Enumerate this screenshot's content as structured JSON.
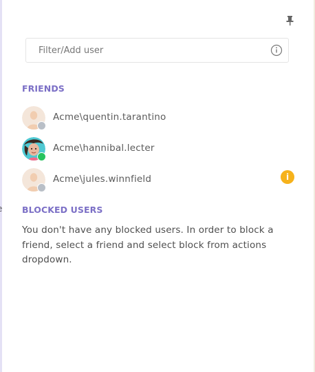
{
  "left_edge_fragment": "e",
  "search": {
    "placeholder": "Filter/Add user"
  },
  "friends": {
    "title": "FRIENDS",
    "items": [
      {
        "name": "Acme\\quentin.tarantino",
        "status": "offline",
        "avatar": "default-avatar-icon"
      },
      {
        "name": "Acme\\hannibal.lecter",
        "status": "online",
        "avatar": "photo"
      },
      {
        "name": "Acme\\jules.winnfield",
        "status": "offline",
        "avatar": "default-avatar-icon",
        "badge": "i"
      }
    ]
  },
  "blocked": {
    "title": "BLOCKED USERS",
    "message": "You don't have any blocked users. In order to block a friend, select a friend and select block from actions dropdown."
  },
  "colors": {
    "section_title": "#7b6fc6",
    "online": "#27c35f",
    "offline": "#b9bfc7",
    "warning_badge": "#f6b21b"
  }
}
